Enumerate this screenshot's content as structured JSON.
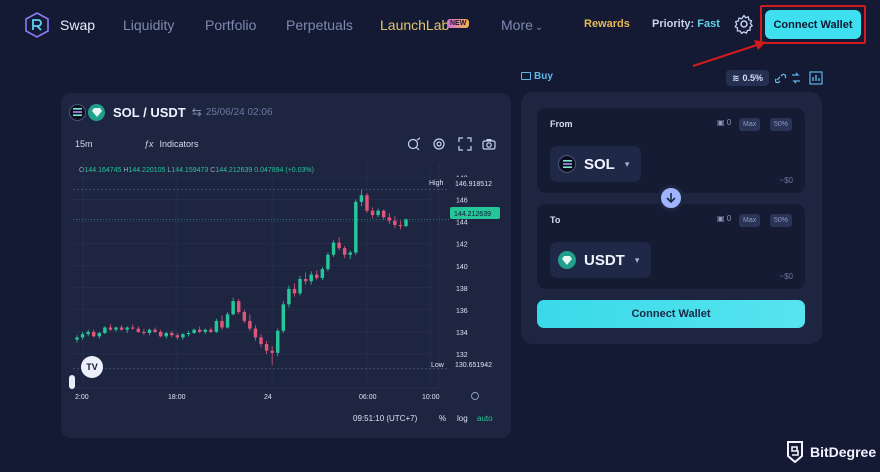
{
  "nav": {
    "items": [
      "Swap",
      "Liquidity",
      "Portfolio",
      "Perpetuals",
      "LaunchLab",
      "More"
    ],
    "launch_badge": "NEW",
    "rewards": "Rewards",
    "priority_label": "Priority:",
    "priority_value": "Fast",
    "connect_wallet": "Connect Wallet"
  },
  "chart_panel": {
    "pair": "SOL / USDT",
    "swap_icon": "⇆",
    "date": "25/06/24 02:06",
    "interval": "15m",
    "indicators": "Indicators",
    "ohlc": {
      "o_label": "O",
      "o": "144.164745",
      "h_label": "H",
      "h": "144.220105",
      "l_label": "L",
      "l": "144.159473",
      "c_label": "C",
      "c": "144.212639",
      "change": "0.047894 (+0.03%)"
    },
    "high_label": "High",
    "high_value": "146.918512",
    "last_value": "144.212639",
    "low_label": "Low",
    "low_value": "130.651942",
    "tv_logo": "TV",
    "bottom": {
      "time": "09:51:10 (UTC+7)",
      "pct": "%",
      "log": "log",
      "auto": "auto"
    }
  },
  "chart_data": {
    "type": "candlestick",
    "title": "SOL / USDT",
    "y_ticks": [
      132,
      134,
      136,
      138,
      140,
      142,
      144,
      146,
      148
    ],
    "x_ticks": [
      "2:00",
      "18:00",
      "24",
      "06:00",
      "10:00"
    ],
    "ylim": [
      130,
      148.6
    ],
    "candles": [
      [
        133.3,
        133.7,
        133.0,
        133.5
      ],
      [
        133.5,
        134.0,
        133.3,
        133.8
      ],
      [
        133.8,
        134.2,
        133.6,
        134.0
      ],
      [
        134.0,
        134.2,
        133.5,
        133.6
      ],
      [
        133.6,
        134.0,
        133.4,
        133.9
      ],
      [
        133.9,
        134.5,
        133.8,
        134.4
      ],
      [
        134.4,
        134.7,
        134.1,
        134.2
      ],
      [
        134.2,
        134.5,
        134.0,
        134.4
      ],
      [
        134.4,
        134.6,
        134.1,
        134.2
      ],
      [
        134.2,
        134.5,
        133.9,
        134.4
      ],
      [
        134.4,
        134.7,
        134.2,
        134.3
      ],
      [
        134.3,
        134.5,
        133.9,
        134.0
      ],
      [
        134.0,
        134.3,
        133.7,
        133.9
      ],
      [
        133.9,
        134.3,
        133.7,
        134.2
      ],
      [
        134.2,
        134.4,
        133.9,
        134.0
      ],
      [
        134.0,
        134.2,
        133.5,
        133.6
      ],
      [
        133.6,
        134.0,
        133.4,
        133.9
      ],
      [
        133.9,
        134.1,
        133.5,
        133.7
      ],
      [
        133.7,
        133.9,
        133.3,
        133.5
      ],
      [
        133.5,
        133.9,
        133.3,
        133.8
      ],
      [
        133.8,
        134.1,
        133.6,
        133.9
      ],
      [
        133.9,
        134.3,
        133.8,
        134.2
      ],
      [
        134.2,
        134.5,
        133.9,
        134.0
      ],
      [
        134.0,
        134.3,
        133.8,
        134.2
      ],
      [
        134.2,
        134.4,
        133.9,
        134.0
      ],
      [
        134.0,
        135.2,
        133.9,
        135.0
      ],
      [
        135.0,
        135.5,
        134.2,
        134.4
      ],
      [
        134.4,
        135.8,
        134.3,
        135.6
      ],
      [
        135.6,
        137.1,
        135.5,
        136.8
      ],
      [
        136.8,
        137.0,
        135.6,
        135.8
      ],
      [
        135.8,
        136.0,
        134.8,
        135.0
      ],
      [
        135.0,
        135.6,
        134.1,
        134.3
      ],
      [
        134.3,
        134.6,
        133.2,
        133.5
      ],
      [
        133.5,
        133.8,
        132.6,
        132.9
      ],
      [
        132.9,
        133.2,
        132.0,
        132.3
      ],
      [
        132.3,
        132.7,
        131.0,
        132.1
      ],
      [
        132.1,
        134.3,
        131.8,
        134.1
      ],
      [
        134.1,
        136.8,
        133.9,
        136.5
      ],
      [
        136.5,
        138.2,
        136.2,
        137.9
      ],
      [
        137.9,
        138.4,
        137.2,
        137.5
      ],
      [
        137.5,
        139.1,
        137.3,
        138.8
      ],
      [
        138.8,
        139.4,
        138.3,
        138.6
      ],
      [
        138.6,
        139.5,
        138.3,
        139.2
      ],
      [
        139.2,
        139.6,
        138.7,
        138.9
      ],
      [
        138.9,
        139.9,
        138.7,
        139.7
      ],
      [
        139.7,
        141.2,
        139.5,
        141.0
      ],
      [
        141.0,
        142.3,
        140.8,
        142.1
      ],
      [
        142.1,
        142.6,
        141.4,
        141.6
      ],
      [
        141.6,
        141.8,
        140.7,
        141.0
      ],
      [
        141.0,
        141.4,
        140.6,
        141.2
      ],
      [
        141.2,
        146.0,
        141.0,
        145.8
      ],
      [
        145.8,
        146.9,
        145.4,
        146.4
      ],
      [
        146.4,
        146.6,
        144.8,
        145.0
      ],
      [
        145.0,
        145.3,
        144.3,
        144.6
      ],
      [
        144.6,
        145.2,
        144.4,
        145.0
      ],
      [
        145.0,
        145.1,
        144.2,
        144.4
      ],
      [
        144.4,
        144.8,
        143.8,
        144.1
      ],
      [
        144.1,
        144.5,
        143.4,
        143.7
      ],
      [
        143.7,
        144.1,
        143.3,
        143.6
      ],
      [
        143.6,
        144.3,
        143.5,
        144.2
      ]
    ]
  },
  "swap": {
    "buy_label": "Buy",
    "slippage": "0.5%",
    "from_label": "From",
    "to_label": "To",
    "balance": "0",
    "max": "Max",
    "fifty": "50%",
    "from_token": "SOL",
    "to_token": "USDT",
    "from_amount": "~$0",
    "to_amount": "~$0",
    "connect_wallet": "Connect Wallet"
  },
  "brand": {
    "bitdegree": "BitDegree"
  },
  "colors": {
    "accent": "#3ee0ef",
    "up": "#27c59a",
    "down": "#e0567a",
    "bg": "#141a33",
    "panel": "#1d2540"
  }
}
